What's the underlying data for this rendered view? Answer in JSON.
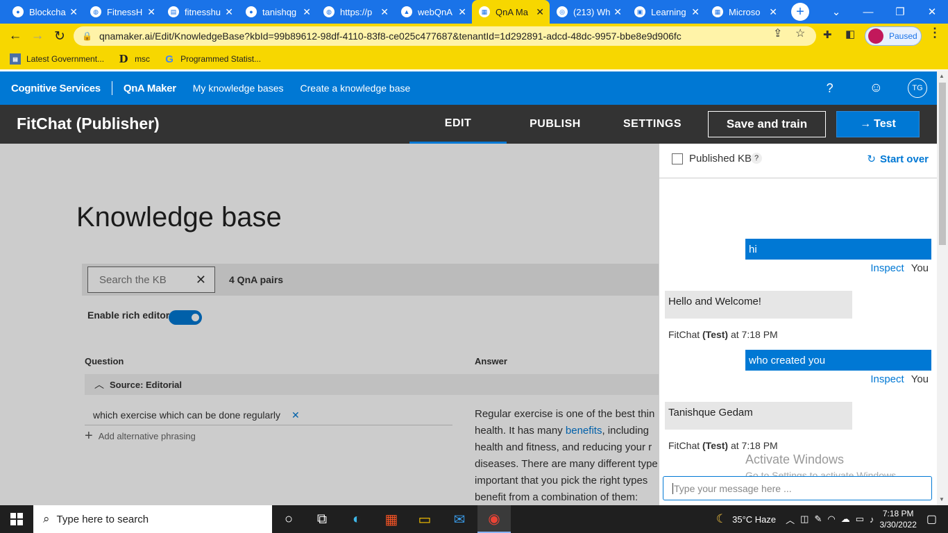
{
  "browser": {
    "tabs": [
      {
        "title": "Blockcha",
        "icon": "github-icon"
      },
      {
        "title": "FitnessH",
        "icon": "globe-icon"
      },
      {
        "title": "fitnesshu",
        "icon": "doc-icon"
      },
      {
        "title": "tanishqg",
        "icon": "github-icon"
      },
      {
        "title": "https://p",
        "icon": "globe-icon"
      },
      {
        "title": "webQnA",
        "icon": "azure-icon"
      },
      {
        "title": "QnA Ma",
        "icon": "microsoft-icon"
      },
      {
        "title": "(213) Wh",
        "icon": "whatsapp-icon"
      },
      {
        "title": "Learning",
        "icon": "learn-icon"
      },
      {
        "title": "Microso",
        "icon": "microsoft-icon"
      }
    ],
    "url": "qnamaker.ai/Edit/KnowledgeBase?kbId=99b89612-98df-4110-83f8-ce025c477687&tenantId=1d292891-adcd-48dc-9957-bbe8e9d906fc",
    "profile_label": "Paused",
    "bookmarks": [
      "Latest Government...",
      "msc",
      "Programmed Statist..."
    ],
    "colors": {
      "frame": "#1a73e8",
      "toolbar": "#f7d700"
    }
  },
  "app": {
    "brand": "Cognitive Services",
    "product": "QnA Maker",
    "nav_links": [
      "My knowledge bases",
      "Create a knowledge base"
    ],
    "help": "?",
    "avatar_initials": "TG",
    "kb_name": "FitChat (Publisher)",
    "tabs": [
      "EDIT",
      "PUBLISH",
      "SETTINGS"
    ],
    "save_train": "Save and train",
    "test_label": "Test",
    "accent": "#0078d4"
  },
  "kb": {
    "title": "Knowledge base",
    "search_placeholder": "Search the KB",
    "pair_count": "4 QnA pairs",
    "rich_editor_label": "Enable rich editor",
    "rich_editor_on": true,
    "col_question": "Question",
    "col_answer": "Answer",
    "source": "Source: Editorial",
    "question": "which exercise which can be done regularly",
    "add_alt": "Add alternative phrasing",
    "answer_lines": [
      {
        "before": "Regular exercise is one of the best thin",
        "link": "",
        "after": ""
      },
      {
        "before": "health. It has many ",
        "link": "benefits",
        "after": ", including"
      },
      {
        "before": "health and fitness, and reducing your r",
        "link": "",
        "after": ""
      },
      {
        "before": "diseases. There are many different type",
        "link": "",
        "after": ""
      },
      {
        "before": "important that you pick the right types",
        "link": "",
        "after": ""
      },
      {
        "before": "benefit from a combination of them:",
        "link": "",
        "after": ""
      }
    ]
  },
  "test_panel": {
    "published_kb": "Published KB",
    "help": "?",
    "start_over": "Start over",
    "inspect": "Inspect",
    "you": "You",
    "messages": [
      {
        "from": "user",
        "text": "hi"
      },
      {
        "from": "bot",
        "text": "Hello and Welcome!",
        "bot": "FitChat",
        "tag": "(Test)",
        "time": "at 7:18 PM"
      },
      {
        "from": "user",
        "text": "who created you"
      },
      {
        "from": "bot",
        "text": "Tanishque Gedam",
        "bot": "FitChat",
        "tag": "(Test)",
        "time": "at 7:18 PM"
      }
    ],
    "input_placeholder": "Type your message here ...",
    "watermark_title": "Activate Windows",
    "watermark_sub": "Go to Settings to activate Windows."
  },
  "taskbar": {
    "search_placeholder": "Type here to search",
    "weather": "35°C  Haze",
    "time": "7:18 PM",
    "date": "3/30/2022"
  }
}
